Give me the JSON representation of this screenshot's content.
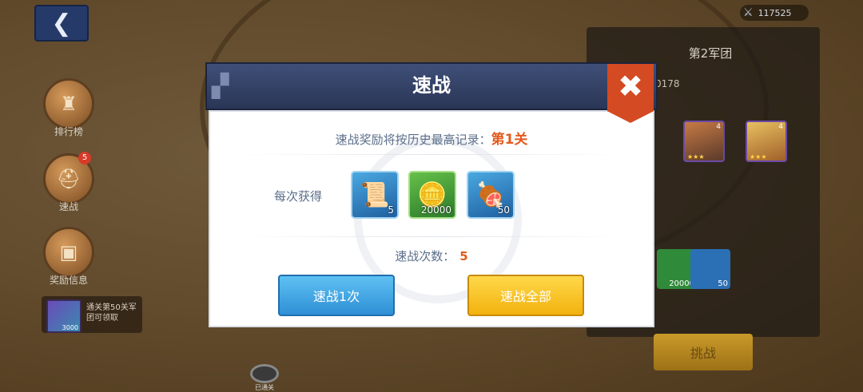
{
  "background": {
    "power_value": "117525",
    "side_buttons": [
      {
        "label": "排行榜",
        "icon": "ranking-icon"
      },
      {
        "label": "速战",
        "icon": "helmet-icon",
        "badge": "5"
      },
      {
        "label": "奖励信息",
        "icon": "chest-icon"
      }
    ],
    "reward_info": {
      "text": "通关第50关军团可领取",
      "amount": "3000"
    },
    "right_panel": {
      "title": "第2军团",
      "code": "0178"
    },
    "peek_rewards": [
      {
        "qty": "20000"
      },
      {
        "qty": "50"
      }
    ],
    "hero_levels": [
      "4",
      "4"
    ],
    "challenge_label": "挑战",
    "stage_marker_label": "已通关"
  },
  "modal": {
    "title": "速战",
    "record_prefix": "速战奖励将按历史最高记录：",
    "record_stage": "第1关",
    "each_label": "每次获得",
    "rewards": [
      {
        "name": "scroll-item",
        "qty": "5",
        "color": "#2b7fc4"
      },
      {
        "name": "gold-coin-item",
        "qty": "20000",
        "color": "#3aa04a"
      },
      {
        "name": "meat-item",
        "qty": "50",
        "color": "#2b7fc4"
      }
    ],
    "count_label": "速战次数：",
    "count_value": "5",
    "once_button": "速战1次",
    "all_button": "速战全部"
  },
  "colors": {
    "accent_orange": "#e35a1c",
    "close_red": "#d44a22",
    "header_navy": "#2f3c60"
  }
}
